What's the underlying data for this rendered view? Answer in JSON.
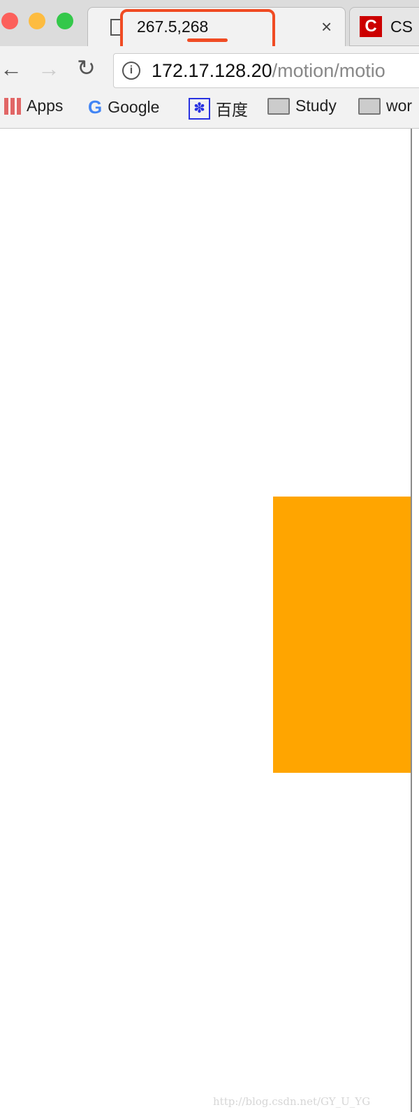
{
  "tabs": [
    {
      "title": "267.5,268",
      "active": true,
      "icon": "document-icon"
    },
    {
      "title": "CS",
      "active": false,
      "icon": "csdn-icon"
    }
  ],
  "address": {
    "host": "172.17.128.20",
    "path": "/motion/motio"
  },
  "bookmarks": [
    {
      "label": "Apps",
      "icon": "apps-grid-icon"
    },
    {
      "label": "Google",
      "icon": "google-icon"
    },
    {
      "label": "百度",
      "icon": "baidu-paw-icon"
    },
    {
      "label": "Study",
      "icon": "folder-icon"
    },
    {
      "label": "wor",
      "icon": "folder-icon"
    }
  ],
  "page": {
    "box_color": "#FFA500"
  },
  "annotation_color": "#F04B23",
  "watermark": "http://blog.csdn.net/GY_U_YG"
}
